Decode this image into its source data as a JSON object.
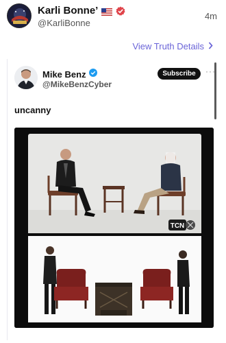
{
  "post": {
    "author_name": "Karli Bonne’",
    "author_handle": "@KarliBonne",
    "time_ago": "4m",
    "view_details_label": "View Truth Details",
    "flag_icon": "us-flag-icon",
    "verified_icon": "verified-badge-icon"
  },
  "quoted": {
    "author_name": "Mike Benz",
    "author_handle": "@MikeBenzCyber",
    "subscribe_label": "Subscribe",
    "more_label": "···",
    "text": "uncanny",
    "watermark": "TCN"
  },
  "colors": {
    "link": "#6a64d8",
    "verified_orange": "#e0444b",
    "verified_blue": "#1d9bf0",
    "subscribe_bg": "#111111"
  }
}
